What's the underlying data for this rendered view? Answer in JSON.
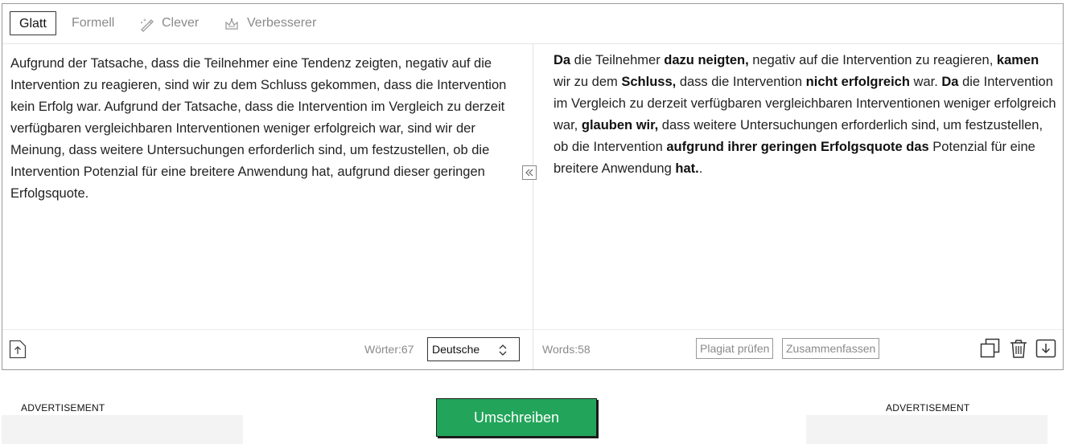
{
  "tabs": [
    {
      "label": "Glatt",
      "icon": null,
      "active": true
    },
    {
      "label": "Formell",
      "icon": null,
      "active": false
    },
    {
      "label": "Clever",
      "icon": "pen-sparkle-icon",
      "active": false
    },
    {
      "label": "Verbesserer",
      "icon": "crown-icon",
      "active": false
    }
  ],
  "input": {
    "text": "Aufgrund der Tatsache, dass die Teilnehmer eine Tendenz zeigten, negativ auf die Intervention zu reagieren, sind wir zu dem Schluss gekommen, dass die Intervention kein Erfolg war. Aufgrund der Tatsache, dass die Intervention im Vergleich zu derzeit verfügbaren vergleichbaren Interventionen weniger erfolgreich war, sind wir der Meinung, dass weitere Untersuchungen erforderlich sind, um festzustellen, ob die Intervention Potenzial für eine breitere Anwendung hat, aufgrund dieser geringen Erfolgsquote.",
    "word_count": "Wörter:67",
    "language": "Deutsche"
  },
  "output": {
    "segments": [
      {
        "t": "Da",
        "b": true
      },
      {
        "t": " die Teilnehmer ",
        "b": false
      },
      {
        "t": "dazu neigten,",
        "b": true
      },
      {
        "t": " negativ auf die Intervention zu reagieren, ",
        "b": false
      },
      {
        "t": "kamen",
        "b": true
      },
      {
        "t": " wir zu dem ",
        "b": false
      },
      {
        "t": "Schluss,",
        "b": true
      },
      {
        "t": " dass die Intervention ",
        "b": false
      },
      {
        "t": "nicht erfolgreich",
        "b": true
      },
      {
        "t": " war. ",
        "b": false
      },
      {
        "t": "Da",
        "b": true
      },
      {
        "t": " die Intervention im Vergleich zu derzeit verfügbaren vergleichbaren Interventionen weniger erfolgreich war, ",
        "b": false
      },
      {
        "t": "glauben wir,",
        "b": true
      },
      {
        "t": " dass weitere Untersuchungen erforderlich sind, um festzustellen, ob die Intervention ",
        "b": false
      },
      {
        "t": "aufgrund ihrer geringen Erfolgsquote das",
        "b": true
      },
      {
        "t": " Potenzial für eine breitere Anwendung ",
        "b": false
      },
      {
        "t": "hat.",
        "b": true
      },
      {
        "t": ".",
        "b": false
      }
    ],
    "word_count": "Words:58",
    "plagiarism_label": "Plagiat prüfen",
    "summarize_label": "Zusammenfassen"
  },
  "actions": {
    "rewrite_label": "Umschreiben",
    "ad_left": "ADVERTISEMENT",
    "ad_right": "ADVERTISEMENT"
  },
  "colors": {
    "accent": "#22a55a",
    "border": "#9a9a9a",
    "muted": "#8a8a8a"
  }
}
